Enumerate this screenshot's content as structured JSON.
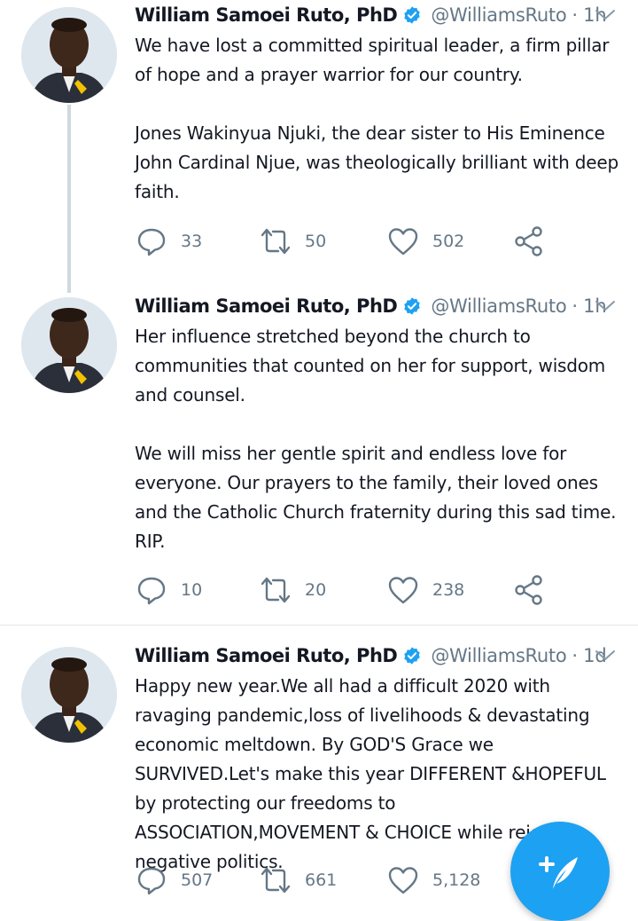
{
  "tweets": [
    {
      "name": "William Samoei Ruto, PhD",
      "handle": "@WilliamsRuto",
      "time": "1h",
      "paragraphs": [
        "We have lost a committed spiritual leader, a firm pillar of hope and a prayer warrior for our country.",
        "Jones Wakinyua Njuki, the dear sister to His Eminence John Cardinal Njue, was theologically brilliant with deep faith."
      ],
      "replies": "33",
      "retweets": "50",
      "likes": "502"
    },
    {
      "name": "William Samoei Ruto, PhD",
      "handle": "@WilliamsRuto",
      "time": "1h",
      "paragraphs": [
        "Her influence stretched beyond the church to communities that counted on her for support, wisdom and counsel.",
        "We will miss her gentle spirit and endless love for everyone. Our prayers to the family, their loved ones and the Catholic Church fraternity during this sad time. RIP."
      ],
      "replies": "10",
      "retweets": "20",
      "likes": "238"
    },
    {
      "name": "William Samoei Ruto, PhD",
      "handle": "@WilliamsRuto",
      "time": "1d",
      "paragraphs": [
        "Happy new year.We all had a difficult 2020 with ravaging pandemic,loss of livelihoods & devastating economic meltdown. By GOD'S Grace we SURVIVED.Let's make this year DIFFERENT &HOPEFUL by protecting our freedoms to ASSOCIATION,MOVEMENT & CHOICE while rejecting negative politics."
      ],
      "replies": "507",
      "retweets": "661",
      "likes": "5,128"
    }
  ],
  "separator": "·",
  "colors": {
    "accent": "#1da1f2",
    "muted": "#657786",
    "text": "#141823"
  },
  "icons": [
    "verified-icon",
    "chevron-down-icon",
    "reply-icon",
    "retweet-icon",
    "like-icon",
    "share-icon",
    "compose-icon"
  ]
}
